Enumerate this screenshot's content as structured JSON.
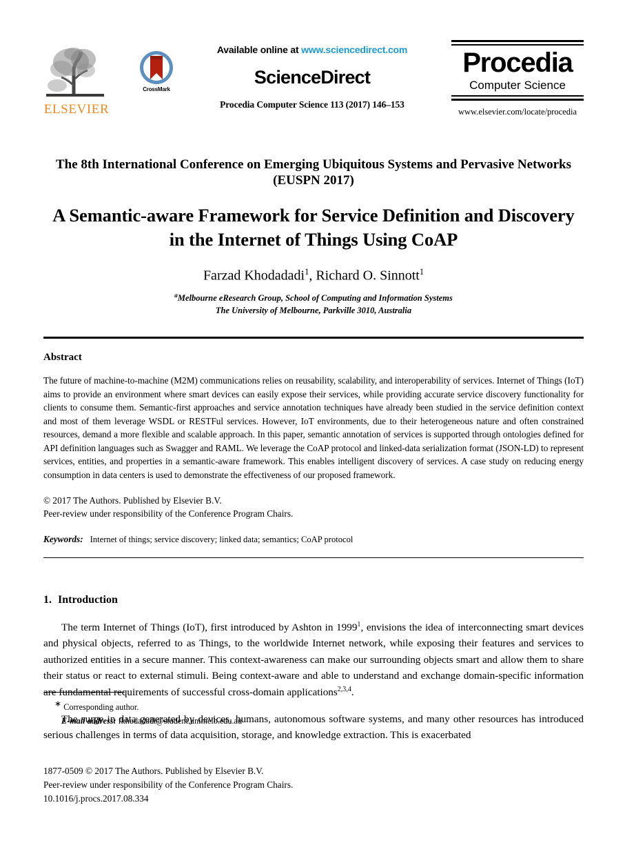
{
  "masthead": {
    "elsevier_logo_word": "ELSEVIER",
    "crossmark_label": "CrossMark",
    "available_prefix": "Available online at ",
    "sciencedirect_url": "www.sciencedirect.com",
    "sciencedirect_wordmark": "ScienceDirect",
    "citation_line": "Procedia Computer Science 113 (2017) 146–153",
    "procedia_title": "Procedia",
    "procedia_subtitle": "Computer Science",
    "procedia_url": "www.elsevier.com/locate/procedia",
    "colors": {
      "elsevier_orange": "#f18a1e",
      "link_blue": "#1c9ad6",
      "crossmark_ring": "#4a7fb5",
      "crossmark_ribbon": "#b3200f"
    }
  },
  "header": {
    "conference_line1": "The 8th International Conference on Emerging Ubiquitous Systems and Pervasive Networks",
    "conference_line2": "(EUSPN 2017)",
    "title_line1": "A Semantic-aware Framework for Service Definition and Discovery",
    "title_line2": "in the Internet of Things Using CoAP",
    "author1_name": "Farzad Khodadadi",
    "author1_sup": "1",
    "author_separator": ", ",
    "author2_name": "Richard O. Sinnott",
    "author2_sup": "1",
    "affiliation_sup": "a",
    "affiliation_line1": "Melbourne eResearch Group, School of Computing and Information Systems",
    "affiliation_line2": "The University of Melbourne, Parkville 3010, Australia"
  },
  "abstract": {
    "heading": "Abstract",
    "text": "The future of machine-to-machine (M2M) communications relies on reusability, scalability, and interoperability of services. Internet of Things (IoT) aims to provide an environment where smart devices can easily expose their services, while providing accurate service discovery functionality for clients to consume them. Semantic-first approaches and service annotation techniques have already been studied in the service definition context and most of them leverage WSDL or RESTFul services. However, IoT environments, due to their heterogeneous nature and often constrained resources, demand a more flexible and scalable approach. In this paper, semantic annotation of services is supported through ontologies defined for API definition languages such as Swagger and RAML. We leverage the CoAP protocol and linked-data serialization format (JSON-LD) to represent services, entities, and properties in a semantic-aware framework. This enables intelligent discovery of services. A case study on reducing energy consumption in data centers is used to demonstrate the effectiveness of our proposed framework.",
    "copyright_line1": "© 2017 The Authors. Published by Elsevier B.V.",
    "copyright_line2": "Peer-review under responsibility of the Conference Program Chairs.",
    "keywords_label": "Keywords:",
    "keywords_values": "Internet of things; service discovery; linked data; semantics; CoAP protocol"
  },
  "introduction": {
    "section_number": "1.",
    "section_title": "Introduction",
    "paragraph1_part1": "The term Internet of Things (IoT), first introduced by Ashton in 1999",
    "paragraph1_sup1": "1",
    "paragraph1_part2": ", envisions the idea of interconnecting smart devices and physical objects, referred to as Things, to the worldwide Internet network, while exposing their features and services to authorized entities in a secure manner. This context-awareness can make our surrounding objects smart and allow them to share their status or react to external stimuli. Being context-aware and able to understand and exchange domain-specific information are fundamental requirements of successful cross-domain applications",
    "paragraph1_sup2": "2,3,4",
    "paragraph1_part3": ".",
    "paragraph2": "The surge in data generated by devices, humans, autonomous software systems, and many other resources has introduced serious challenges in terms of data acquisition, storage, and knowledge extraction. This is exacerbated"
  },
  "footnote": {
    "marker": "∗",
    "corresponding_author": "Corresponding author.",
    "email_label": "E-mail address:",
    "email_value": "fkhodadadi@student.unimelb.edu.au"
  },
  "page_footer": {
    "line1": "1877-0509 © 2017 The Authors. Published by Elsevier B.V.",
    "line2": "Peer-review under responsibility of the Conference Program Chairs.",
    "line3": "10.1016/j.procs.2017.08.334"
  }
}
